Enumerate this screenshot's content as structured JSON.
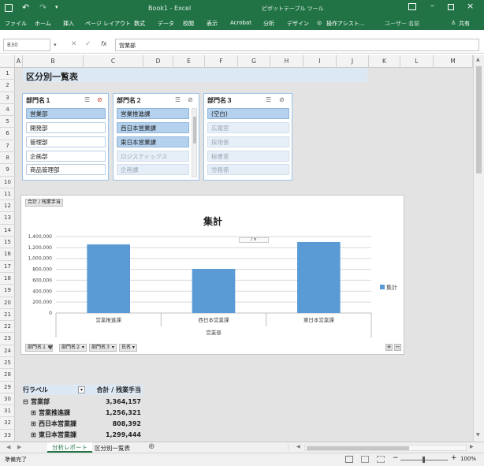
{
  "window": {
    "title": "Book1 - Excel",
    "context_tool": "ピボットテーブル ツール",
    "user": "ユーザー 名前",
    "share": "共有"
  },
  "ribbon": {
    "tabs": [
      "ファイル",
      "ホーム",
      "挿入",
      "ページ レイアウト",
      "数式",
      "データ",
      "校閲",
      "表示",
      "Acrobat",
      "分析",
      "デザイン"
    ],
    "tell_me": "操作アシスト..."
  },
  "formula_bar": {
    "name_box": "B30",
    "value": "営業部"
  },
  "columns": [
    "A",
    "B",
    "C",
    "D",
    "E",
    "F",
    "G",
    "H",
    "I",
    "J",
    "K",
    "L",
    "M"
  ],
  "rows": [
    "1",
    "2",
    "3",
    "4",
    "5",
    "6",
    "7",
    "8",
    "9",
    "10",
    "11",
    "12",
    "13",
    "14",
    "15",
    "16",
    "17",
    "18",
    "19",
    "20",
    "21",
    "22",
    "23",
    "24",
    "25",
    "28",
    "29",
    "30",
    "31",
    "32",
    "33"
  ],
  "heading": "区分別一覧表",
  "slicers": [
    {
      "title": "部門名１",
      "items": [
        {
          "label": "営業部",
          "state": "sel"
        },
        {
          "label": "開発部",
          "state": "norm"
        },
        {
          "label": "管理部",
          "state": "norm"
        },
        {
          "label": "企画部",
          "state": "norm"
        },
        {
          "label": "商品管理部",
          "state": "norm"
        }
      ]
    },
    {
      "title": "部門名２",
      "items": [
        {
          "label": "営業推進課",
          "state": "sel"
        },
        {
          "label": "西日本営業課",
          "state": "sel"
        },
        {
          "label": "東日本営業課",
          "state": "sel"
        },
        {
          "label": "ロジスティックス",
          "state": "dim"
        },
        {
          "label": "企画課",
          "state": "dim"
        }
      ]
    },
    {
      "title": "部門名３",
      "items": [
        {
          "label": "(空白)",
          "state": "sel"
        },
        {
          "label": "広報室",
          "state": "dim"
        },
        {
          "label": "採用係",
          "state": "dim"
        },
        {
          "label": "秘書室",
          "state": "dim"
        },
        {
          "label": "労務係",
          "state": "dim"
        }
      ]
    }
  ],
  "chart_data": {
    "type": "bar",
    "title": "集計",
    "value_field": "合計 / 残業手当",
    "categories": [
      "営業推進課",
      "西日本営業課",
      "東日本営業課"
    ],
    "group_label": "営業部",
    "values": [
      1256321,
      808392,
      1299444
    ],
    "ylim": [
      0,
      1400000
    ],
    "yticks": [
      "0",
      "200,000",
      "400,000",
      "600,000",
      "800,000",
      "1,000,000",
      "1,200,000",
      "1,400,000"
    ],
    "legend": "集計",
    "legend_position": "right",
    "bar_color": "#5b9bd5",
    "grid": true,
    "axis_fields": [
      "部門名１",
      "部門名２",
      "部門名３",
      "氏名"
    ]
  },
  "pivot": {
    "header_label": "行ラベル",
    "header_value": "合計 / 残業手当",
    "rows": [
      {
        "label": "営業部",
        "value": "3,364,157",
        "level": 0
      },
      {
        "label": "営業推進課",
        "value": "1,256,321",
        "level": 1
      },
      {
        "label": "西日本営業課",
        "value": "808,392",
        "level": 1
      },
      {
        "label": "東日本営業課",
        "value": "1,299,444",
        "level": 1
      }
    ]
  },
  "sheets": [
    "分析レポート",
    "区分別一覧表"
  ],
  "status": {
    "ready": "準備完了",
    "zoom": "100%"
  }
}
